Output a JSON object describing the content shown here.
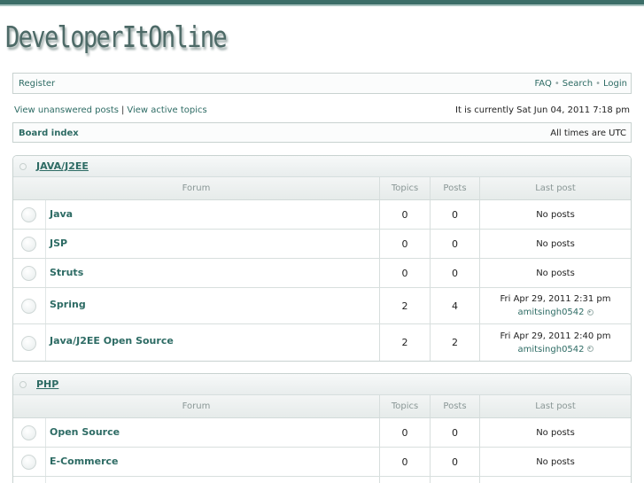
{
  "site": {
    "logo_text": "DeveloperItOnline"
  },
  "nav": {
    "register": "Register",
    "faq": "FAQ",
    "search": "Search",
    "login": "Login",
    "separator": "•"
  },
  "links": {
    "unanswered": "View unanswered posts",
    "pipe": "|",
    "active": "View active topics",
    "current_time": "It is currently Sat Jun 04, 2011 7:18 pm"
  },
  "breadcrumb": {
    "board_index": "Board index",
    "timezone": "All times are UTC"
  },
  "columns": {
    "forum": "Forum",
    "topics": "Topics",
    "posts": "Posts",
    "last_post": "Last post"
  },
  "categories": [
    {
      "title": "JAVA/J2EE",
      "forums": [
        {
          "name": "Java",
          "topics": "0",
          "posts": "0",
          "last": "No posts",
          "by": ""
        },
        {
          "name": "JSP",
          "topics": "0",
          "posts": "0",
          "last": "No posts",
          "by": ""
        },
        {
          "name": "Struts",
          "topics": "0",
          "posts": "0",
          "last": "No posts",
          "by": ""
        },
        {
          "name": "Spring",
          "topics": "2",
          "posts": "4",
          "last": "Fri Apr 29, 2011 2:31 pm",
          "by": "amitsingh0542"
        },
        {
          "name": "Java/J2EE Open Source",
          "topics": "2",
          "posts": "2",
          "last": "Fri Apr 29, 2011 2:40 pm",
          "by": "amitsingh0542"
        }
      ]
    },
    {
      "title": "PHP",
      "forums": [
        {
          "name": "Open Source",
          "topics": "0",
          "posts": "0",
          "last": "No posts",
          "by": ""
        },
        {
          "name": "E-Commerce",
          "topics": "0",
          "posts": "0",
          "last": "No posts",
          "by": ""
        }
      ]
    }
  ],
  "icons": {
    "forum_bullet": "circle-icon",
    "view_latest": "arrow-right-icon"
  }
}
